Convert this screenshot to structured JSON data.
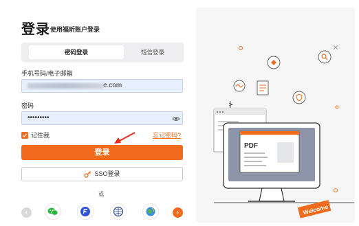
{
  "header": {
    "title": "登录",
    "subtitle": "使用福昕账户登录"
  },
  "tabs": [
    {
      "label": "密码登录",
      "active": true
    },
    {
      "label": "短信登录",
      "active": false
    }
  ],
  "account": {
    "label": "手机号码/电子邮箱",
    "value_suffix": "e.com"
  },
  "password": {
    "label": "密码",
    "value": "•••••••••"
  },
  "remember": {
    "label": "记住我",
    "checked": true
  },
  "forgot_label": "忘记密码?",
  "login_button": "登录",
  "sso_button": "SSO登录",
  "divider_text": "或",
  "social_icons": [
    "left-arrow-icon",
    "wechat-icon",
    "foxit-icon",
    "network-icon",
    "globe-icon",
    "right-arrow-icon"
  ],
  "illustration": {
    "pdf_label": "PDF",
    "welcome_label": "Welcome"
  },
  "colors": {
    "accent": "#f26a1b",
    "input_bg": "#e8effc",
    "panel_bg": "#f6f6f7"
  }
}
